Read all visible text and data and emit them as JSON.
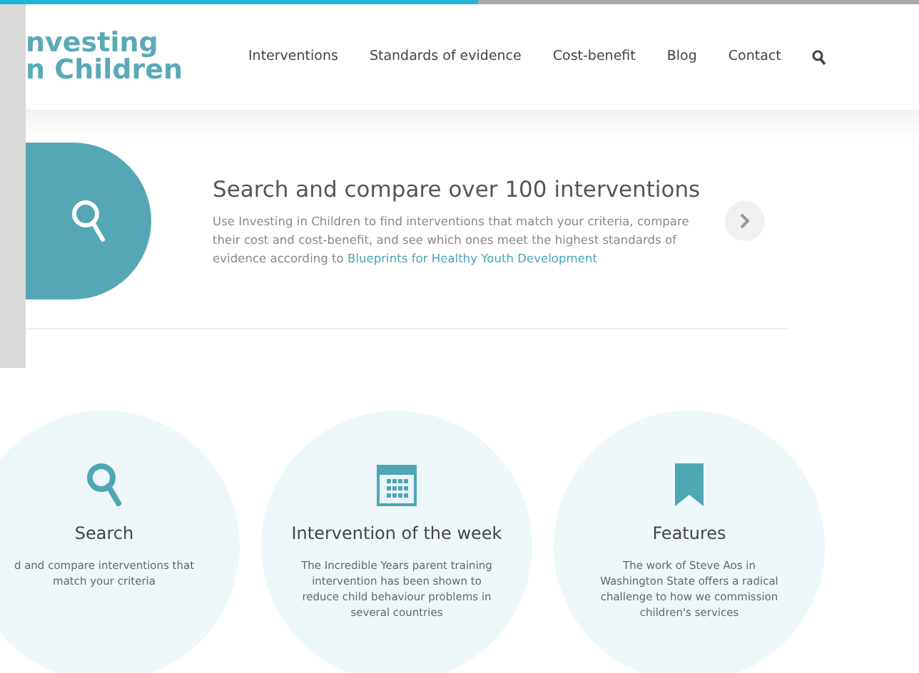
{
  "loading_bar": {
    "level": 0.52
  },
  "header": {
    "logo_lines": [
      "nvesting",
      "n Children"
    ],
    "nav": [
      {
        "label": "Interventions"
      },
      {
        "label": "Standards of evidence"
      },
      {
        "label": "Cost-benefit"
      },
      {
        "label": "Blog"
      },
      {
        "label": "Contact"
      }
    ]
  },
  "hero": {
    "title": "Search and compare over 100 interventions",
    "text_before_link": "Use Investing in Children to find interventions that match your criteria, compare their cost and cost-benefit, and see which ones meet the highest standards of evidence according to",
    "link": "Blueprints for Healthy Youth Development"
  },
  "cards": [
    {
      "kind": "search",
      "title": "Search",
      "text": "d and compare interventions that match your criteria"
    },
    {
      "kind": "calendar",
      "title": "Intervention of the week",
      "text": "The Incredible Years parent training intervention has been shown to reduce child behaviour problems in several countries"
    },
    {
      "kind": "bookmark",
      "title": "Features",
      "text": "The work of Steve Aos in Washington State offers a radical challenge to how we commission children's services"
    }
  ]
}
